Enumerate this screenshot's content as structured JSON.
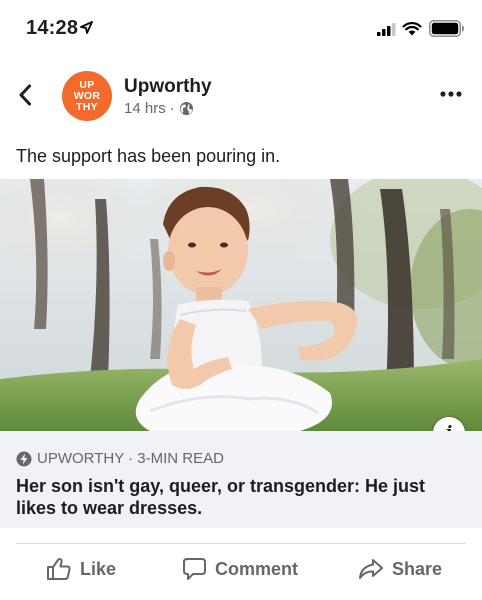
{
  "status_bar": {
    "time": "14:28"
  },
  "post": {
    "page_name": "Upworthy",
    "avatar_lines": [
      "UP",
      "WOR",
      "THY"
    ],
    "timestamp": "14 hrs",
    "separator": "·",
    "caption": "The support has been pouring in."
  },
  "link_card": {
    "source": "UPWORTHY · 3-MIN READ",
    "title": "Her son isn't gay, queer, or transgender: He just likes to wear dresses.",
    "info_glyph": "i"
  },
  "actions": {
    "like": "Like",
    "comment": "Comment",
    "share": "Share"
  },
  "colors": {
    "brand_orange": "#f26b2c",
    "muted_text": "#65676b",
    "card_bg": "#f0f2f5"
  }
}
